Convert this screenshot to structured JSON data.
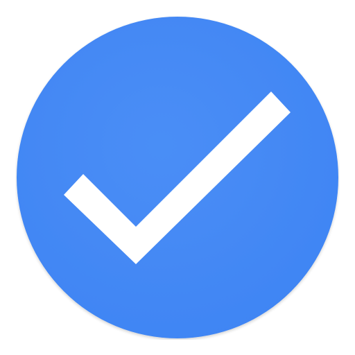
{
  "icon": {
    "name": "check-circle-icon",
    "colors": {
      "circle": "#4286f4",
      "circle_shade": "#3b7ae8",
      "check": "#ffffff",
      "background": "#ffffff"
    }
  }
}
